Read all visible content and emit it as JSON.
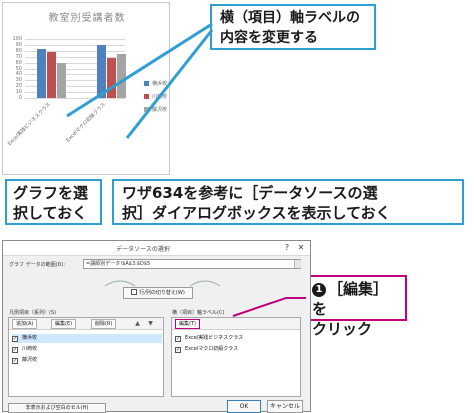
{
  "chart": {
    "title": "教室別受講者数",
    "category_labels": [
      "Excel実践ビジネスクラス",
      "Excelマクロ初級クラス"
    ]
  },
  "chart_data": {
    "type": "bar",
    "title": "教室別受講者数",
    "categories": [
      "Excel実践ビジネスクラス",
      "Excelマクロ初級クラス"
    ],
    "series": [
      {
        "name": "横浜校",
        "values": [
          83,
          89
        ]
      },
      {
        "name": "川崎校",
        "values": [
          78,
          67
        ]
      },
      {
        "name": "藤沢校",
        "values": [
          60,
          75
        ]
      }
    ],
    "colors": [
      "#4f81bd",
      "#c0504d",
      "#a5a5a5"
    ],
    "ylim": [
      0,
      100
    ],
    "yticks": [
      "0",
      "10",
      "20",
      "30",
      "40",
      "50",
      "60",
      "70",
      "80",
      "90",
      "100"
    ],
    "grid": true,
    "legend": "right"
  },
  "callouts": {
    "edit_axis_line1": "横（項目）軸ラベルの",
    "edit_axis_line2": "内容を変更する",
    "select_graph_line1": "グラフを選",
    "select_graph_line2": "択しておく",
    "open_dialog_line1": "ワザ634を参考に［データソースの選",
    "open_dialog_line2": "択］ダイアログボックスを表示しておく",
    "click_badge": "1",
    "click_line1": "［編集］を",
    "click_line2": "クリック"
  },
  "dialog": {
    "title": "データソースの選択",
    "close_symbol": "✕",
    "help_symbol": "?",
    "range_label": "グラフ データの範囲(D):",
    "range_value": "=講師別データ!$A$3:$D$5",
    "switch_button": "行/列の切り替え(W)",
    "legend_group_label": "凡例項目（系列）(S)",
    "axis_group_label": "横（項目）軸ラベル(C)",
    "add_button": "追加(A)",
    "edit_series_button": "編集(E)",
    "delete_button": "削除(R)",
    "up_arrow": "▲",
    "down_arrow": "▼",
    "edit_axis_button": "編集(T)",
    "series_items": [
      "横浜校",
      "川崎校",
      "藤沢校"
    ],
    "axis_items": [
      "Excel実践ビジネスクラス",
      "Excelマクロ初級クラス"
    ],
    "hidden_cells_button": "非表示および空白のセル(H)",
    "ok_button": "OK",
    "cancel_button": "キャンセル"
  }
}
